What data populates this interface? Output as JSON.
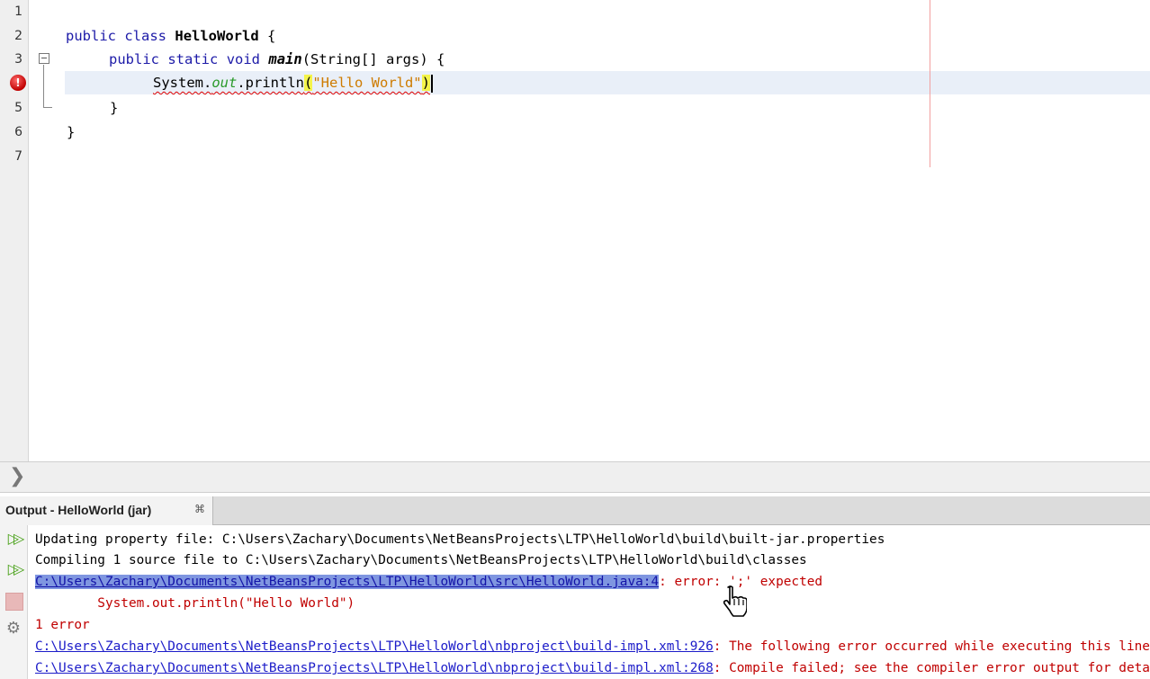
{
  "editor": {
    "line_numbers": [
      "1",
      "2",
      "3",
      "",
      "5",
      "6",
      "7"
    ],
    "error_icon_glyph": "!",
    "lines": {
      "l2": {
        "kw1": "public",
        "kw2": "class",
        "name": "HelloWorld",
        "brace": "{"
      },
      "l3": {
        "kw1": "public",
        "kw2": "static",
        "kw3": "void",
        "method": "main",
        "params": "(String[] args) {"
      },
      "l4": {
        "obj": "System.",
        "field": "out",
        "call": ".println",
        "open": "(",
        "str": "\"Hello World\"",
        "close": ")"
      },
      "l5": {
        "text": "}"
      },
      "l6": {
        "text": "}"
      }
    }
  },
  "output": {
    "tab_label": "Output - HelloWorld (jar)",
    "tab_close": "⌘",
    "lines": [
      {
        "kind": "plain",
        "text": "Updating property file: C:\\Users\\Zachary\\Documents\\NetBeansProjects\\LTP\\HelloWorld\\build\\built-jar.properties"
      },
      {
        "kind": "plain",
        "text": "Compiling 1 source file to C:\\Users\\Zachary\\Documents\\NetBeansProjects\\LTP\\HelloWorld\\build\\classes"
      },
      {
        "kind": "link",
        "link": "C:\\Users\\Zachary\\Documents\\NetBeansProjects\\LTP\\HelloWorld\\src\\HelloWorld.java:4",
        "rest": ": error: ';' expected"
      },
      {
        "kind": "err",
        "text": "        System.out.println(\"Hello World\")"
      },
      {
        "kind": "err",
        "text": "1 error"
      },
      {
        "kind": "link",
        "link": "C:\\Users\\Zachary\\Documents\\NetBeansProjects\\LTP\\HelloWorld\\nbproject\\build-impl.xml:926",
        "rest": ": The following error occurred while executing this line:"
      },
      {
        "kind": "link",
        "link": "C:\\Users\\Zachary\\Documents\\NetBeansProjects\\LTP\\HelloWorld\\nbproject\\build-impl.xml:268",
        "rest": ": Compile failed; see the compiler error output for details."
      }
    ]
  },
  "colors": {
    "keyword": "#1d1ba8",
    "string": "#ce7b00",
    "error": "#c00000",
    "link": "#1c1cc9"
  },
  "icons": [
    "error-icon",
    "fold-icon",
    "expand-icon",
    "rerun-icon",
    "rerun-alt-icon",
    "stop-icon",
    "settings-icon",
    "hand-cursor-icon"
  ]
}
